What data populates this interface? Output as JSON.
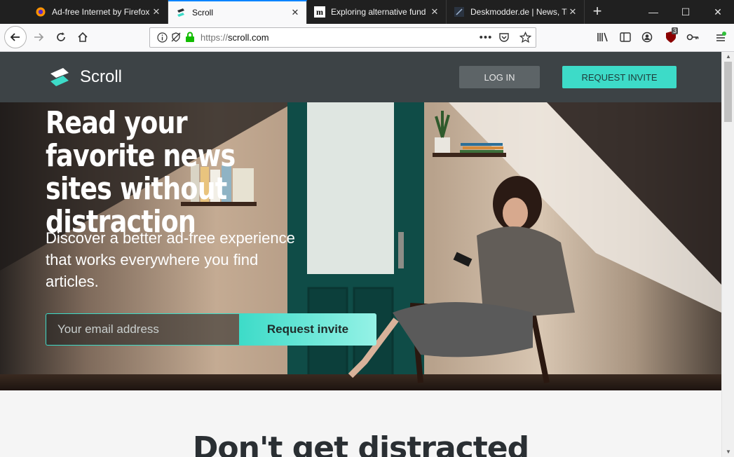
{
  "browser": {
    "tabs": [
      {
        "title": "Ad-free Internet by Firefox",
        "icon": "firefox-icon"
      },
      {
        "title": "Scroll",
        "icon": "scroll-icon",
        "active": true
      },
      {
        "title": "Exploring alternative fund",
        "icon": "medium-icon"
      },
      {
        "title": "Deskmodder.de | News, Tip",
        "icon": "deskmodder-icon"
      }
    ],
    "url": {
      "scheme": "https://",
      "host": "scroll.com"
    },
    "ublock_count": "3"
  },
  "site": {
    "brand": "Scroll",
    "login_label": "LOG IN",
    "invite_label": "REQUEST INVITE"
  },
  "hero": {
    "title": "Read your favorite news sites without distraction",
    "subtitle": "Discover a better ad-free experience that works everywhere you find articles.",
    "email_placeholder": "Your email address",
    "cta_label": "Request invite"
  },
  "section": {
    "title": "Don't get distracted"
  },
  "colors": {
    "accent": "#3ddbc8",
    "header_bg": "#3d4346",
    "tab_active_border": "#0a84ff"
  }
}
